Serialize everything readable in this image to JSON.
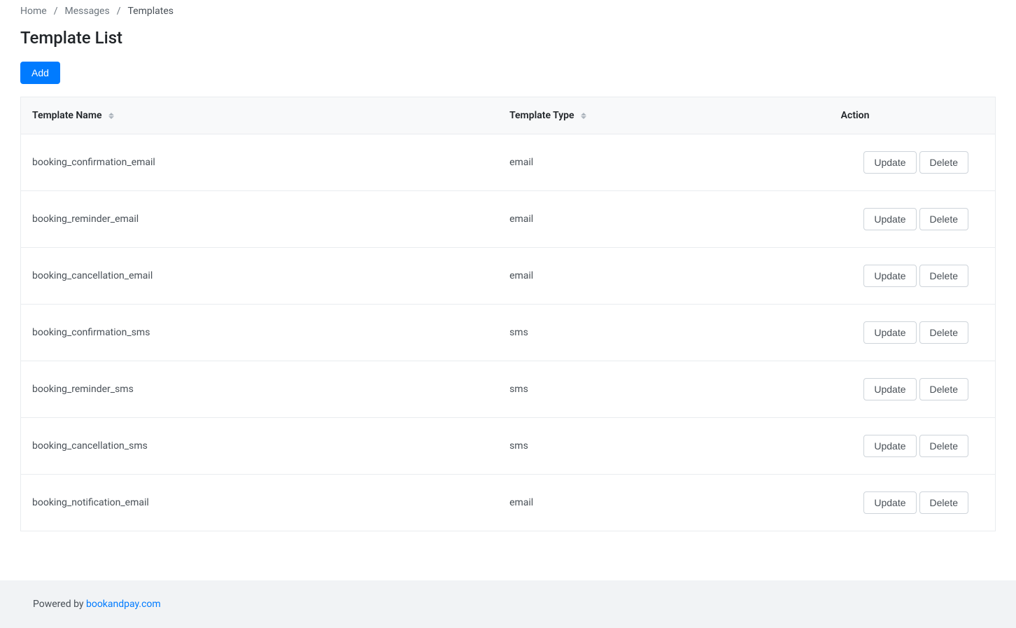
{
  "breadcrumb": {
    "home": "Home",
    "messages": "Messages",
    "current": "Templates"
  },
  "page_title": "Template List",
  "buttons": {
    "add": "Add",
    "update": "Update",
    "delete": "Delete"
  },
  "table": {
    "headers": {
      "name": "Template Name",
      "type": "Template Type",
      "action": "Action"
    },
    "rows": [
      {
        "name": "booking_confirmation_email",
        "type": "email"
      },
      {
        "name": "booking_reminder_email",
        "type": "email"
      },
      {
        "name": "booking_cancellation_email",
        "type": "email"
      },
      {
        "name": "booking_confirmation_sms",
        "type": "sms"
      },
      {
        "name": "booking_reminder_sms",
        "type": "sms"
      },
      {
        "name": "booking_cancellation_sms",
        "type": "sms"
      },
      {
        "name": "booking_notification_email",
        "type": "email"
      }
    ]
  },
  "footer": {
    "text": "Powered by ",
    "link": "bookandpay.com"
  }
}
